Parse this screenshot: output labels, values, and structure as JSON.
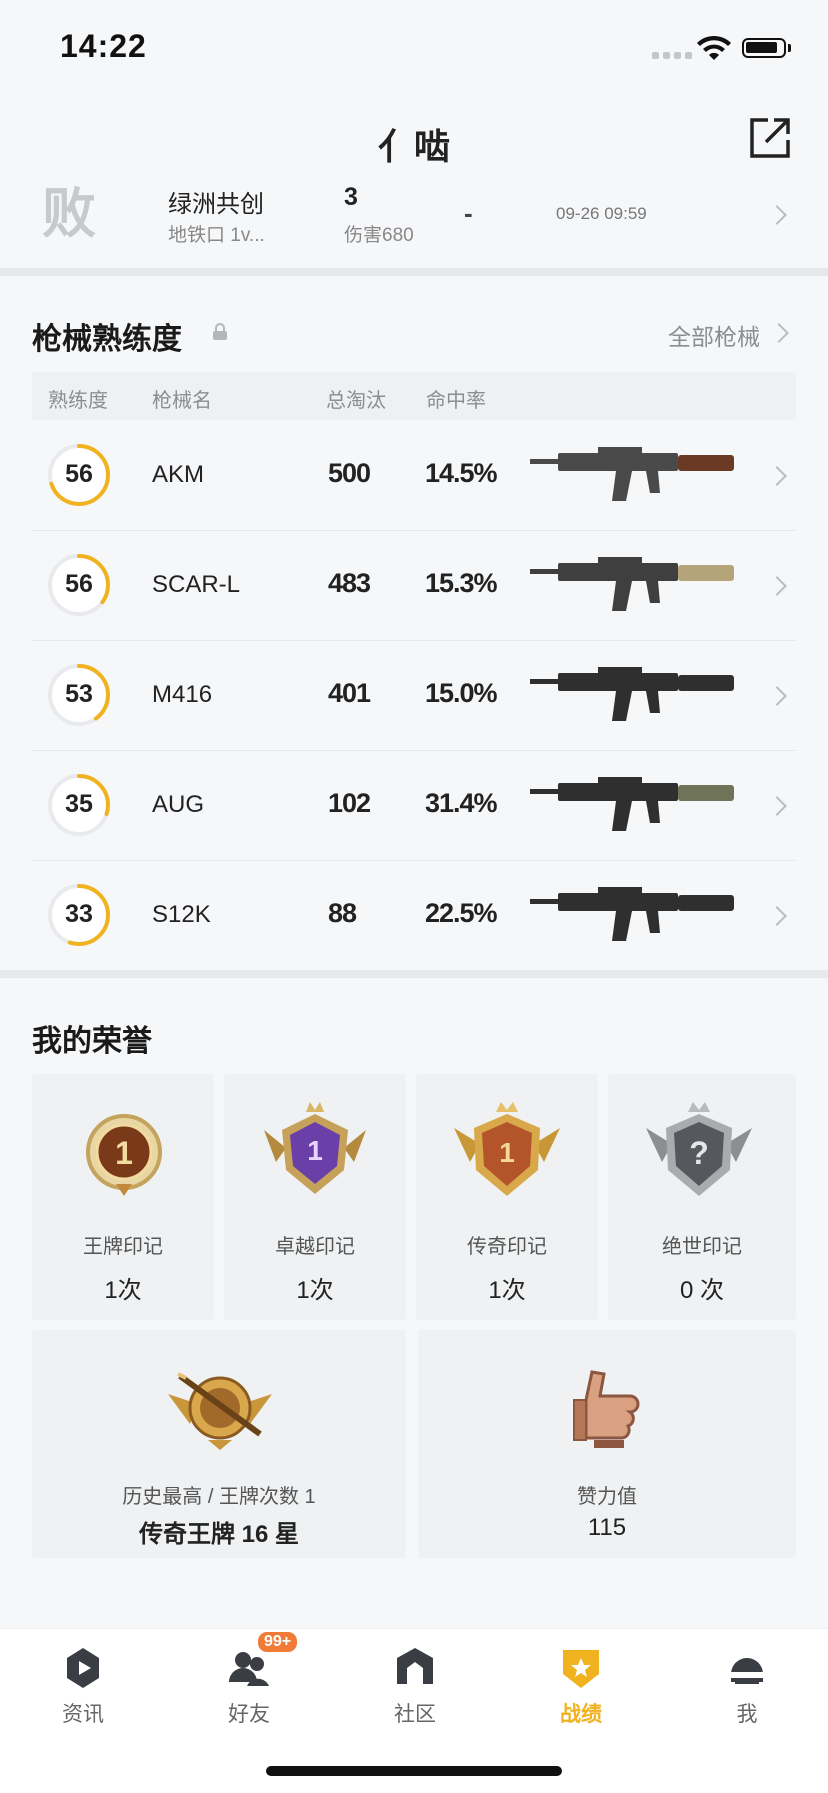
{
  "status_bar": {
    "time": "14:22"
  },
  "header": {
    "title": "亻啮"
  },
  "match": {
    "result": "败",
    "mode": "绿洲共创",
    "map": "地铁口 1v...",
    "kills": "3",
    "damage": "伤害680",
    "rank": "-",
    "time": "09-26 09:59"
  },
  "weapons": {
    "title": "枪械熟练度",
    "all_link": "全部枪械",
    "columns": [
      "熟练度",
      "枪械名",
      "总淘汰",
      "命中率"
    ],
    "rows": [
      {
        "level": "56",
        "name": "AKM",
        "kills": "500",
        "accuracy": "14.5%",
        "progress": 0.7
      },
      {
        "level": "56",
        "name": "SCAR-L",
        "kills": "483",
        "accuracy": "15.3%",
        "progress": 0.35
      },
      {
        "level": "53",
        "name": "M416",
        "kills": "401",
        "accuracy": "15.0%",
        "progress": 0.4
      },
      {
        "level": "35",
        "name": "AUG",
        "kills": "102",
        "accuracy": "31.4%",
        "progress": 0.3
      },
      {
        "level": "33",
        "name": "S12K",
        "kills": "88",
        "accuracy": "22.5%",
        "progress": 0.55
      }
    ]
  },
  "honors": {
    "title": "我的荣誉",
    "marks": [
      {
        "label": "王牌印记",
        "count": "1次",
        "icon": "ace-mark-icon"
      },
      {
        "label": "卓越印记",
        "count": "1次",
        "icon": "excellence-mark-icon"
      },
      {
        "label": "传奇印记",
        "count": "1次",
        "icon": "legend-mark-icon"
      },
      {
        "label": "绝世印记",
        "count": "0 次",
        "icon": "peerless-mark-icon"
      }
    ],
    "highest": {
      "label": "历史最高 / 王牌次数 1",
      "value": "传奇王牌 16 星"
    },
    "likes": {
      "label": "赞力值",
      "value": "115"
    }
  },
  "tabs": [
    {
      "label": "资讯",
      "icon": "news-icon"
    },
    {
      "label": "好友",
      "icon": "friends-icon",
      "badge": "99+"
    },
    {
      "label": "社区",
      "icon": "community-icon"
    },
    {
      "label": "战绩",
      "icon": "record-icon",
      "active": true
    },
    {
      "label": "我",
      "icon": "profile-icon"
    }
  ],
  "colors": {
    "accent": "#f1b21f",
    "ring_track": "#e9eaed",
    "badge": "#f07b36"
  }
}
